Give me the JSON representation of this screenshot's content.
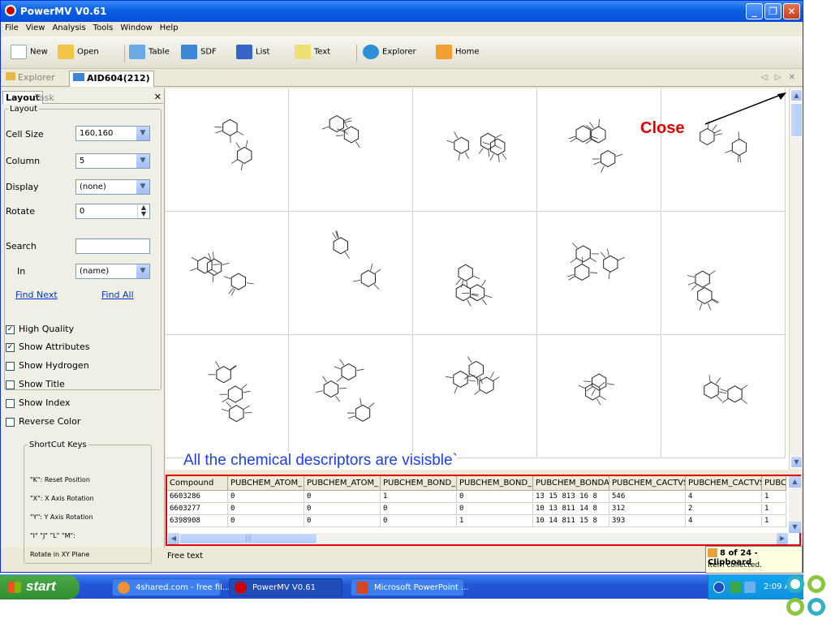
{
  "window": {
    "title": "PowerMV V0.61"
  },
  "menu": [
    "File",
    "View",
    "Analysis",
    "Tools",
    "Window",
    "Help"
  ],
  "toolbar": [
    {
      "label": "New",
      "icon": "new-document-icon"
    },
    {
      "label": "Open",
      "icon": "open-folder-icon"
    },
    {
      "label": "Table",
      "icon": "table-icon"
    },
    {
      "label": "SDF",
      "icon": "sdf-icon"
    },
    {
      "label": "List",
      "icon": "list-icon"
    },
    {
      "label": "Text",
      "icon": "text-icon"
    },
    {
      "label": "Explorer",
      "icon": "explorer-icon"
    },
    {
      "label": "Home",
      "icon": "home-icon"
    }
  ],
  "doc_tabs": {
    "explorer": "Explorer",
    "active": "AID604(212)",
    "nav": "◁ ▷ ✕"
  },
  "left_panel": {
    "tab_layout": "Layout",
    "tab_task": "Task",
    "close": "✕",
    "layout_group": "Layout",
    "cell_size": {
      "label": "Cell Size",
      "value": "160,160"
    },
    "column": {
      "label": "Column",
      "value": "5"
    },
    "display": {
      "label": "Display",
      "value": "(none)"
    },
    "rotate": {
      "label": "Rotate",
      "value": "0"
    },
    "search": {
      "label": "Search",
      "value": ""
    },
    "in": {
      "label": "In",
      "value": "(name)"
    },
    "find_next": "Find Next",
    "find_all": "Find All",
    "checkboxes": [
      {
        "label": "High Quality",
        "checked": true
      },
      {
        "label": "Show Attributes",
        "checked": true
      },
      {
        "label": "Show Hydrogen",
        "checked": false
      },
      {
        "label": "Show Title",
        "checked": false
      },
      {
        "label": "Show Index",
        "checked": false
      },
      {
        "label": "Reverse Color",
        "checked": false
      }
    ],
    "shortcut_group": "ShortCut Keys",
    "shortcuts": [
      "\"K\": Reset Position",
      "\"X\": X Axis Rotation",
      "\"Y\": Y Axis Rotation",
      "\"I\" \"J\" \"L\" \"M\":",
      "Rotate in XY Plane"
    ]
  },
  "annotations": {
    "close": "Close",
    "descriptors": "All the chemical descriptors are visisble`"
  },
  "table": {
    "columns": [
      "Compound",
      "PUBCHEM_ATOM_",
      "PUBCHEM_ATOM_",
      "PUBCHEM_BOND_",
      "PUBCHEM_BOND_",
      "PUBCHEM_BONDA",
      "PUBCHEM_CACTVS",
      "PUBCHEM_CACTVS",
      "PUBC"
    ],
    "rows": [
      [
        "6603286",
        "0",
        "0",
        "1",
        "0",
        "13 15 813 16 8",
        "546",
        "4",
        "1"
      ],
      [
        "6603277",
        "0",
        "0",
        "0",
        "0",
        "10 13 811 14 8",
        "312",
        "2",
        "1"
      ],
      [
        "6398908",
        "0",
        "0",
        "0",
        "1",
        "10 14 811 15 8",
        "393",
        "4",
        "1"
      ]
    ]
  },
  "status": {
    "text": "Free text"
  },
  "clipboard": {
    "title": "8 of 24 - Clipboard",
    "subtitle": "Item collected."
  },
  "taskbar": {
    "start": "start",
    "tasks": [
      "4shared.com - free fil...",
      "PowerMV V0.61",
      "Microsoft PowerPoint ..."
    ],
    "clock": "2:09 A"
  },
  "colors": {
    "title_bar": "#0a5fe0",
    "annotation_red": "#e00000",
    "annotation_blue": "#1f3fdf",
    "taskbar": "#2456d6",
    "start_green": "#2f8e2f"
  }
}
